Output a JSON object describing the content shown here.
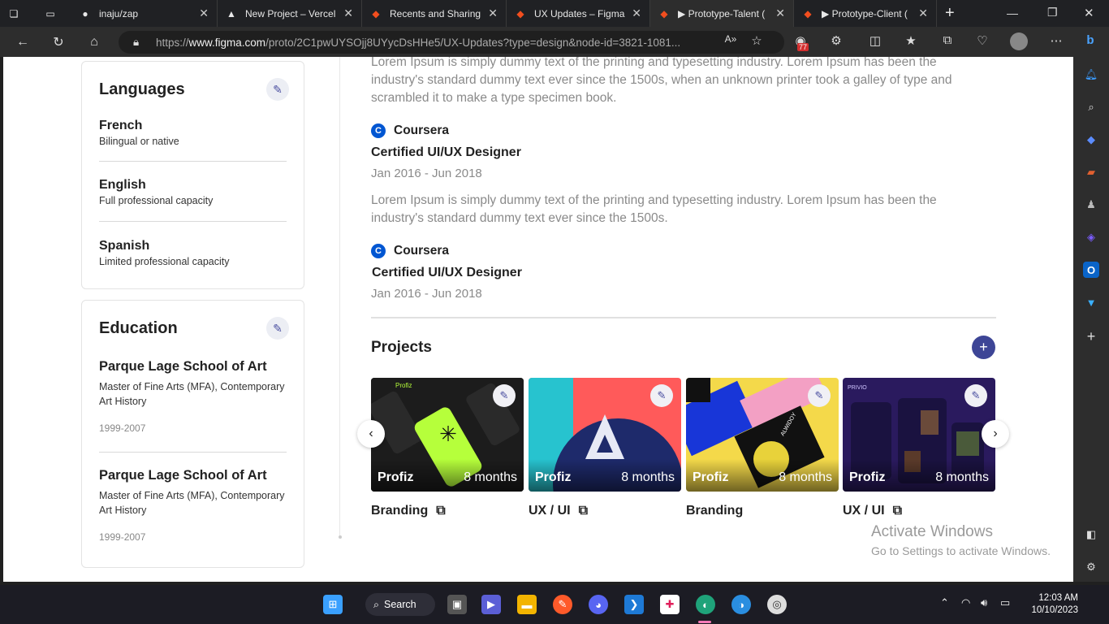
{
  "browser": {
    "tabs": [
      {
        "title": "",
        "icon": "workspaces-icon"
      },
      {
        "title": "",
        "icon": "tab-actions-icon"
      },
      {
        "title": "inaju/zap",
        "icon": "github-icon"
      },
      {
        "title": "New Project – Vercel",
        "icon": "vercel-icon"
      },
      {
        "title": "Recents and Sharing",
        "icon": "figma-icon"
      },
      {
        "title": "UX Updates – Figma",
        "icon": "figma-icon"
      },
      {
        "title": "▶ Prototype-Talent (",
        "icon": "figma-icon"
      },
      {
        "title": "▶ Prototype-Client (",
        "icon": "figma-icon"
      }
    ],
    "url_prefix": "https://",
    "url_host": "www.figma.com",
    "url_path": "/proto/2C1pwUYSOjj8UYycDsHHe5/UX-Updates?type=design&node-id=3821-1081...",
    "badge_count": "77"
  },
  "languages": {
    "title": "Languages",
    "items": [
      {
        "name": "French",
        "level": "Bilingual or native"
      },
      {
        "name": "English",
        "level": "Full professional capacity"
      },
      {
        "name": "Spanish",
        "level": "Limited professional  capacity"
      }
    ]
  },
  "education": {
    "title": "Education",
    "items": [
      {
        "school": "Parque Lage School of Art",
        "degree": "Master of Fine Arts (MFA), Contemporary Art History",
        "years": "1999-2007"
      },
      {
        "school": "Parque Lage School of Art",
        "degree": "Master of Fine Arts (MFA), Contemporary Art History",
        "years": "1999-2007"
      }
    ]
  },
  "certifications": {
    "intro": "Lorem Ipsum is simply dummy text of the printing and typesetting industry. Lorem Ipsum has been the industry's standard dummy text ever since the 1500s, when an unknown printer took a galley of type and scrambled it to make a type specimen book.",
    "items": [
      {
        "provider": "Coursera",
        "title": "Certified UI/UX Designer",
        "dates": "Jan 2016 - Jun 2018",
        "description": "Lorem Ipsum is simply dummy text of the printing and typesetting industry. Lorem Ipsum has been the industry's standard dummy text ever since the 1500s."
      },
      {
        "provider": "Coursera",
        "title": "Certified UI/UX Designer",
        "dates": "Jan 2016 - Jun 2018"
      }
    ]
  },
  "projects": {
    "title": "Projects",
    "items": [
      {
        "name": "Profiz",
        "duration": "8 months",
        "category": "Branding",
        "has_link": true
      },
      {
        "name": "Profiz",
        "duration": "8 months",
        "category": "UX / UI",
        "has_link": true
      },
      {
        "name": "Profiz",
        "duration": "8 months",
        "category": "Branding",
        "has_link": false
      },
      {
        "name": "Profiz",
        "duration": "8 months",
        "category": "UX / UI",
        "has_link": true
      }
    ],
    "thumb_text": {
      "p1": "Profiz",
      "p3": "ALWIDOY",
      "p4": "PRIVIO"
    }
  },
  "watermark": {
    "line1": "Activate Windows",
    "line2": "Go to Settings to activate Windows."
  },
  "taskbar": {
    "search_label": "Search",
    "time": "12:03 AM",
    "date": "10/10/2023"
  },
  "colors": {
    "accent": "#3d4596",
    "coursera": "#0056d2"
  }
}
